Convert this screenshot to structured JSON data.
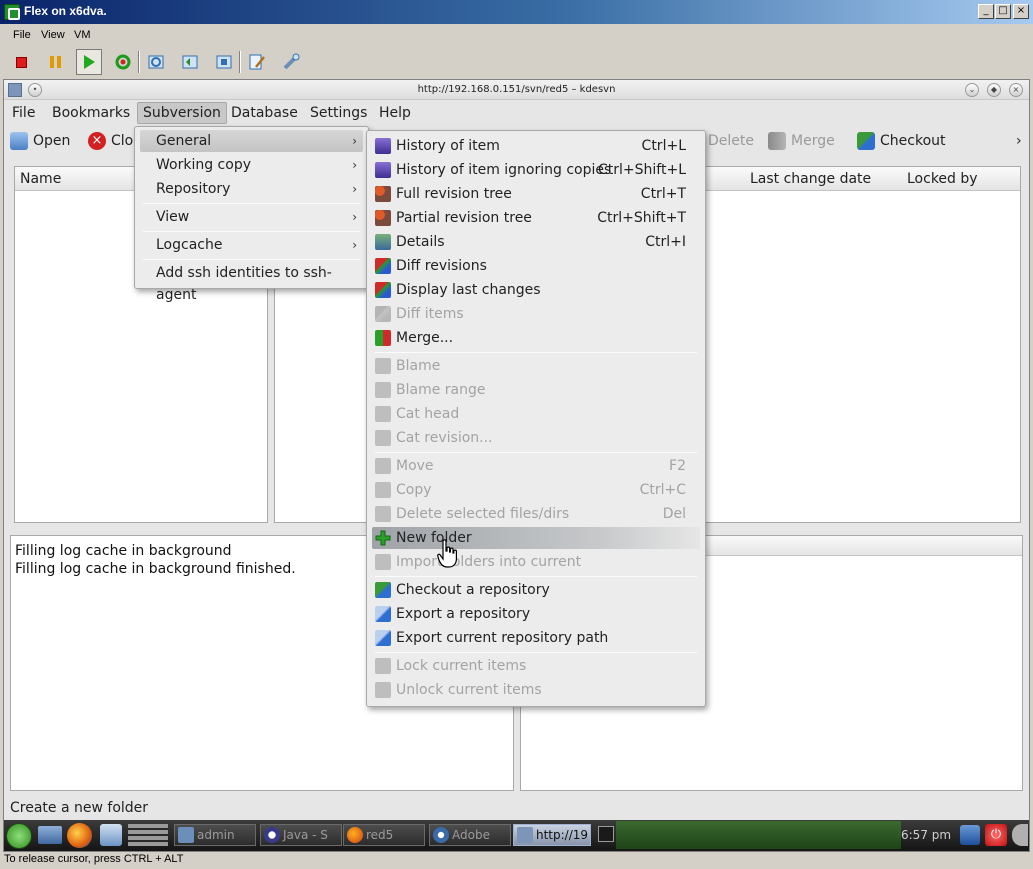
{
  "window": {
    "title": "Flex on x6dva.",
    "buttons": {
      "minimize": "_",
      "maximize": "□",
      "close": "×"
    }
  },
  "vm_menu": [
    "File",
    "View",
    "VM"
  ],
  "vm_toolbar": [
    "stop-icon",
    "pause-icon",
    "play-icon",
    "refresh-icon",
    "snapshot-icon",
    "revert-snapshot-icon",
    "manage-snapshots-icon",
    "edit-settings-icon",
    "tools-icon"
  ],
  "kde": {
    "title": "http://192.168.0.151/svn/red5 – kdesvn",
    "menubar": [
      "File",
      "Bookmarks",
      "Subversion",
      "Database",
      "Settings",
      "Help"
    ],
    "toolbar": {
      "open": "Open",
      "close": "Clo",
      "delete": "Delete",
      "merge": "Merge",
      "checkout": "Checkout",
      "more": "›"
    },
    "columns": {
      "name": "Name",
      "last_change_date": "Last change date",
      "locked_by": "Locked by"
    },
    "log": [
      "Filling log cache in background",
      "Filling log cache in background finished."
    ],
    "status": "Create a new folder"
  },
  "subversion_menu": [
    {
      "label": "General",
      "submenu": true,
      "highlighted": true
    },
    {
      "label": "Working copy",
      "submenu": true
    },
    {
      "label": "Repository",
      "submenu": true
    },
    {
      "label": "View",
      "submenu": true
    },
    {
      "label": "Logcache",
      "submenu": true
    },
    {
      "label": "Add ssh identities to ssh-agent"
    }
  ],
  "general_submenu": [
    {
      "label": "History of item",
      "shortcut": "Ctrl+L",
      "icon": "history-icon",
      "enabled": true
    },
    {
      "label": "History of item ignoring copies",
      "shortcut": "Ctrl+Shift+L",
      "icon": "history-icon",
      "enabled": true
    },
    {
      "label": "Full revision tree",
      "shortcut": "Ctrl+T",
      "icon": "revision-tree-icon",
      "enabled": true
    },
    {
      "label": "Partial revision tree",
      "shortcut": "Ctrl+Shift+T",
      "icon": "revision-tree-icon",
      "enabled": true
    },
    {
      "label": "Details",
      "shortcut": "Ctrl+I",
      "icon": "details-icon",
      "enabled": true
    },
    {
      "label": "Diff revisions",
      "shortcut": "",
      "icon": "diff-icon",
      "enabled": true
    },
    {
      "label": "Display last changes",
      "shortcut": "",
      "icon": "diff-icon",
      "enabled": true
    },
    {
      "label": "Diff items",
      "shortcut": "",
      "icon": "diff-icon",
      "enabled": false
    },
    {
      "label": "Merge...",
      "shortcut": "",
      "icon": "merge-icon",
      "enabled": true
    },
    {
      "label": "Blame",
      "shortcut": "",
      "icon": "blame-icon",
      "enabled": false
    },
    {
      "label": "Blame range",
      "shortcut": "",
      "icon": "blame-icon",
      "enabled": false
    },
    {
      "label": "Cat head",
      "shortcut": "",
      "icon": "cat-icon",
      "enabled": false
    },
    {
      "label": "Cat revision...",
      "shortcut": "",
      "icon": "cat-icon",
      "enabled": false
    },
    {
      "label": "Move",
      "shortcut": "F2",
      "icon": "move-icon",
      "enabled": false
    },
    {
      "label": "Copy",
      "shortcut": "Ctrl+C",
      "icon": "copy-icon",
      "enabled": false
    },
    {
      "label": "Delete selected files/dirs",
      "shortcut": "Del",
      "icon": "delete-icon",
      "enabled": false
    },
    {
      "label": "New folder",
      "shortcut": "",
      "icon": "new-folder-icon",
      "enabled": true,
      "highlighted": true
    },
    {
      "label": "Import folders into current",
      "shortcut": "",
      "icon": "import-icon",
      "enabled": false
    },
    {
      "label": "Checkout a repository",
      "shortcut": "",
      "icon": "checkout-icon",
      "enabled": true
    },
    {
      "label": "Export a repository",
      "shortcut": "",
      "icon": "export-icon",
      "enabled": true
    },
    {
      "label": "Export current repository path",
      "shortcut": "",
      "icon": "export-icon",
      "enabled": true
    },
    {
      "label": "Lock current items",
      "shortcut": "",
      "icon": "lock-icon",
      "enabled": false
    },
    {
      "label": "Unlock current items",
      "shortcut": "",
      "icon": "unlock-icon",
      "enabled": false
    }
  ],
  "taskbar": [
    {
      "label": "admin",
      "icon": "folder-icon"
    },
    {
      "label": "Java - S",
      "icon": "eclipse-icon"
    },
    {
      "label": "red5",
      "icon": "firefox-icon"
    },
    {
      "label": "Adobe",
      "icon": "flex-icon"
    },
    {
      "label": "http://19",
      "icon": "kdesvn-icon",
      "active": true
    }
  ],
  "clock": "6:57 pm",
  "host_status": "To release cursor, press CTRL + ALT"
}
